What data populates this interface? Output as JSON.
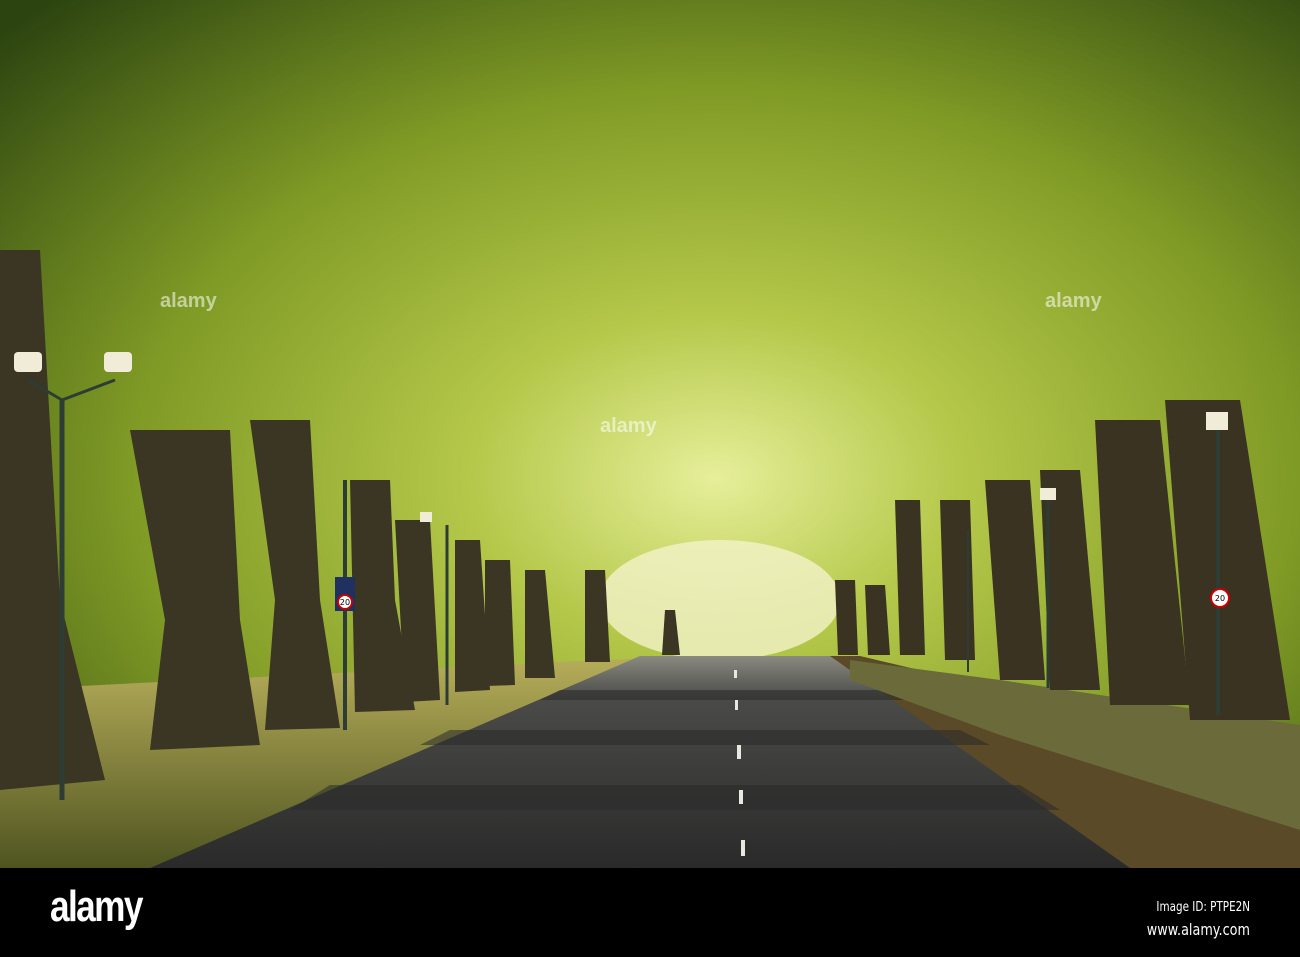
{
  "photo": {
    "subject": "tree-lined avenue",
    "sign_text": "20",
    "colors": {
      "canopy": "#8fae2a",
      "canopy_dark": "#2f4a12",
      "road": "#3a3a3a",
      "trunk": "#3b3524",
      "wall": "#6b6a3a",
      "grass": "#6e7a2a"
    }
  },
  "watermark": {
    "text": "alamy"
  },
  "footer": {
    "logo": "alamy",
    "image_id": "Image ID: PTPE2N",
    "website": "www.alamy.com"
  }
}
